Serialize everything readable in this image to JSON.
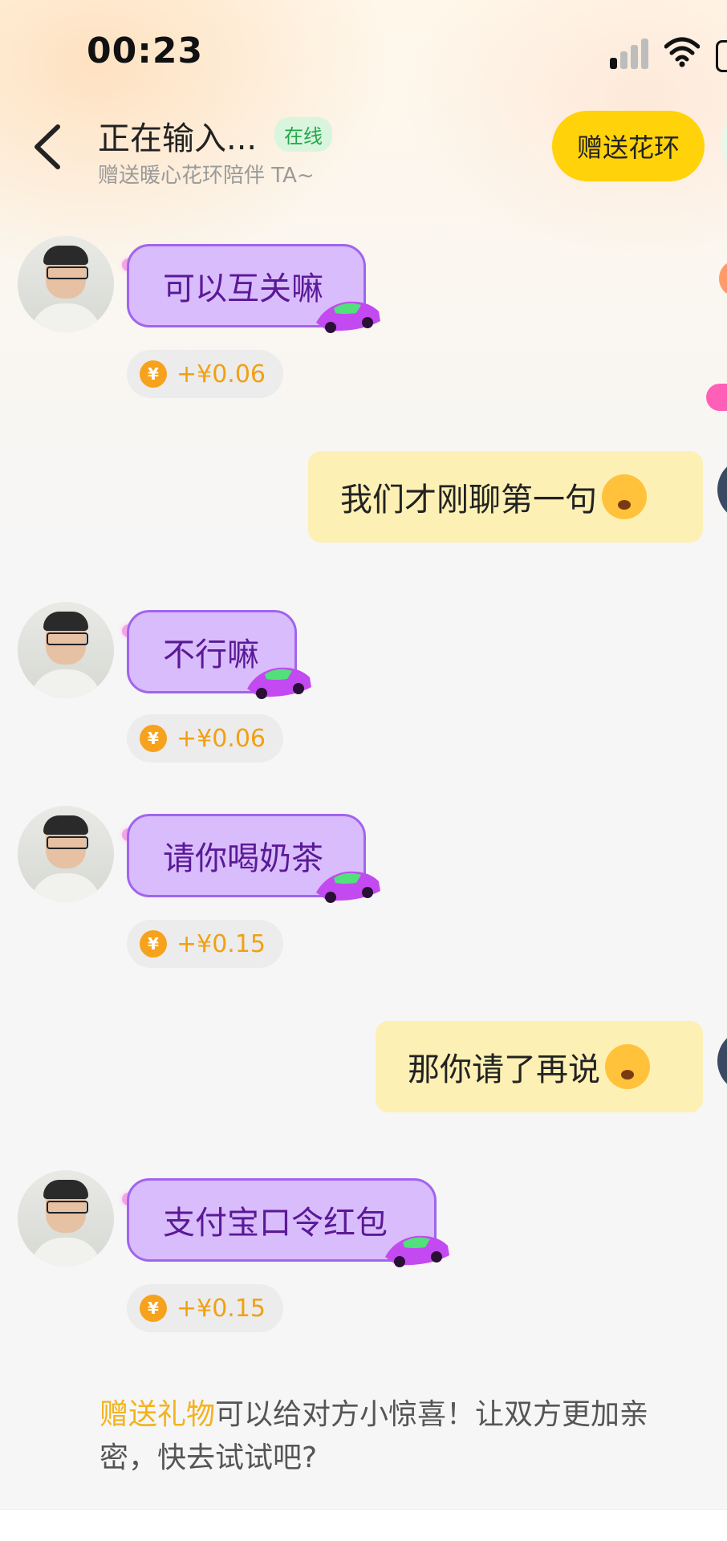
{
  "status_bar": {
    "time": "00:23"
  },
  "header": {
    "title": "正在输入...",
    "online_badge": "在线",
    "subtitle": "赠送暖心花环陪伴 TA~",
    "gift_button": "赠送花环"
  },
  "messages": [
    {
      "side": "in",
      "text": "可以互关嘛",
      "reward": "+¥0.06"
    },
    {
      "side": "out",
      "text": "我们才刚聊第一句"
    },
    {
      "side": "in",
      "text": "不行嘛",
      "reward": "+¥0.06"
    },
    {
      "side": "in",
      "text": "请你喝奶茶",
      "reward": "+¥0.15"
    },
    {
      "side": "out",
      "text": "那你请了再说"
    },
    {
      "side": "in",
      "text": "支付宝口令红包",
      "reward": "+¥0.15"
    }
  ],
  "coin_symbol": "¥",
  "promo": {
    "highlight": "赠送礼物",
    "text": "可以给对方小惊喜！让双方更加亲密，快去试试吧?"
  },
  "colors": {
    "accent_yellow": "#ffd20a",
    "incoming_bubble": "#d9bcfb",
    "outgoing_bubble": "#fdf0b4",
    "online_green": "#23a84a"
  }
}
